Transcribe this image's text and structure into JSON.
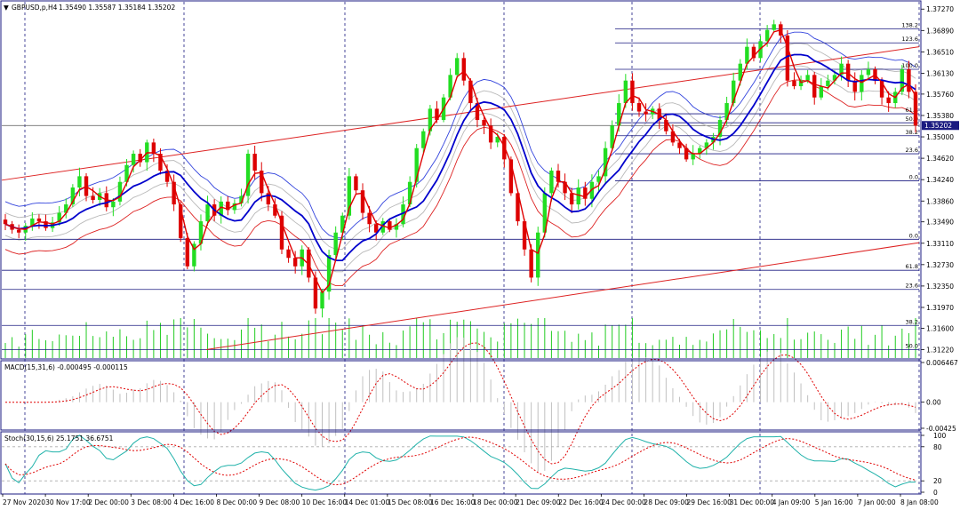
{
  "chart_data": [
    {
      "type": "candlestick",
      "panel": "main",
      "title": "GBPUSD,p,H4",
      "ohlc_readout": "1.35490 1.35587 1.35184 1.35202",
      "current_price": "1.35202",
      "price_labels": [
        "1.37270",
        "1.36890",
        "1.36510",
        "1.36130",
        "1.35760",
        "1.35380",
        "1.35000",
        "1.34620",
        "1.34240",
        "1.33860",
        "1.33490",
        "1.33110",
        "1.32730",
        "1.32350",
        "1.31970",
        "1.31600",
        "1.31220"
      ],
      "ylim": [
        1.3107,
        1.374
      ],
      "x_labels": [
        "27 Nov 2020",
        "30 Nov 17:00",
        "2 Dec 00:00",
        "3 Dec 08:00",
        "4 Dec 16:00",
        "8 Dec 00:00",
        "9 Dec 08:00",
        "10 Dec 16:00",
        "14 Dec 01:00",
        "15 Dec 08:00",
        "16 Dec 16:00",
        "18 Dec 00:00",
        "21 Dec 09:00",
        "22 Dec 16:00",
        "24 Dec 00:00",
        "28 Dec 09:00",
        "29 Dec 16:00",
        "31 Dec 00:00",
        "4 Jan 09:00",
        "5 Jan 16:00",
        "7 Jan 00:00",
        "8 Jan 08:00"
      ],
      "fib_levels_upper": [
        {
          "label": "138.2",
          "price": 1.3692
        },
        {
          "label": "123.6",
          "price": 1.3667
        },
        {
          "label": "100.0",
          "price": 1.362
        },
        {
          "label": "61.8",
          "price": 1.3541
        },
        {
          "label": "50.0",
          "price": 1.3525
        },
        {
          "label": "38.2",
          "price": 1.3502
        },
        {
          "label": "23.6",
          "price": 1.347
        },
        {
          "label": "0.0",
          "price": 1.3422
        }
      ],
      "fib_levels_lower": [
        {
          "label": "0.0",
          "price": 1.3318
        },
        {
          "label": "61.8",
          "price": 1.3263
        },
        {
          "label": "23.6",
          "price": 1.3229
        },
        {
          "label": "38.2",
          "price": 1.3165
        },
        {
          "label": "50.0",
          "price": 1.3122
        }
      ],
      "closes": [
        1.3345,
        1.3335,
        1.333,
        1.3342,
        1.3355,
        1.335,
        1.3338,
        1.3348,
        1.3365,
        1.338,
        1.341,
        1.343,
        1.3395,
        1.3388,
        1.34,
        1.3375,
        1.3385,
        1.342,
        1.345,
        1.347,
        1.3455,
        1.349,
        1.347,
        1.344,
        1.342,
        1.338,
        1.332,
        1.327,
        1.331,
        1.335,
        1.338,
        1.336,
        1.3385,
        1.337,
        1.3382,
        1.3395,
        1.347,
        1.344,
        1.34,
        1.338,
        1.336,
        1.33,
        1.3285,
        1.327,
        1.33,
        1.325,
        1.3195,
        1.3225,
        1.329,
        1.333,
        1.336,
        1.343,
        1.3405,
        1.3365,
        1.3345,
        1.333,
        1.335,
        1.3335,
        1.3345,
        1.338,
        1.342,
        1.348,
        1.351,
        1.355,
        1.353,
        1.357,
        1.361,
        1.364,
        1.36,
        1.356,
        1.353,
        1.352,
        1.349,
        1.35,
        1.346,
        1.34,
        1.335,
        1.33,
        1.325,
        1.333,
        1.34,
        1.344,
        1.342,
        1.34,
        1.338,
        1.341,
        1.339,
        1.342,
        1.343,
        1.348,
        1.352,
        1.356,
        1.36,
        1.356,
        1.3545,
        1.354,
        1.355,
        1.353,
        1.351,
        1.349,
        1.348,
        1.346,
        1.347,
        1.348,
        1.349,
        1.35,
        1.353,
        1.356,
        1.36,
        1.363,
        1.366,
        1.364,
        1.367,
        1.369,
        1.37,
        1.368,
        1.36,
        1.359,
        1.36,
        1.361,
        1.357,
        1.359,
        1.36,
        1.361,
        1.363,
        1.36,
        1.358,
        1.361,
        1.362,
        1.36,
        1.357,
        1.356,
        1.358,
        1.362,
        1.358,
        1.352
      ],
      "series": [
        {
          "name": "MA red",
          "color": "#e00000"
        },
        {
          "name": "MA blue",
          "color": "#0000cc"
        },
        {
          "name": "Envelope blue",
          "color": "#3344dd"
        },
        {
          "name": "Envelope red",
          "color": "#dd2222"
        },
        {
          "name": "Envelope gray",
          "color": "#b8b8b8"
        }
      ],
      "colors": {
        "bull": "#22dd22",
        "bear": "#dd0000",
        "volume": "#22cc22",
        "trendline": "#dd2222",
        "fib": "#1a1a80",
        "vgrid": "#1a1a80"
      }
    },
    {
      "type": "line",
      "panel": "macd",
      "title": "MACD(15,31,6) -0.000495 -0.000115",
      "y_labels": [
        "0.006467",
        "0.00",
        "-0.00425"
      ],
      "ylim": [
        -0.00425,
        0.006467
      ]
    },
    {
      "type": "line",
      "panel": "stoch",
      "title": "Stoch(30,15,6) 25.1751 36.6751",
      "y_labels": [
        "100",
        "80",
        "20",
        "0"
      ],
      "ylim": [
        0,
        100
      ]
    }
  ]
}
